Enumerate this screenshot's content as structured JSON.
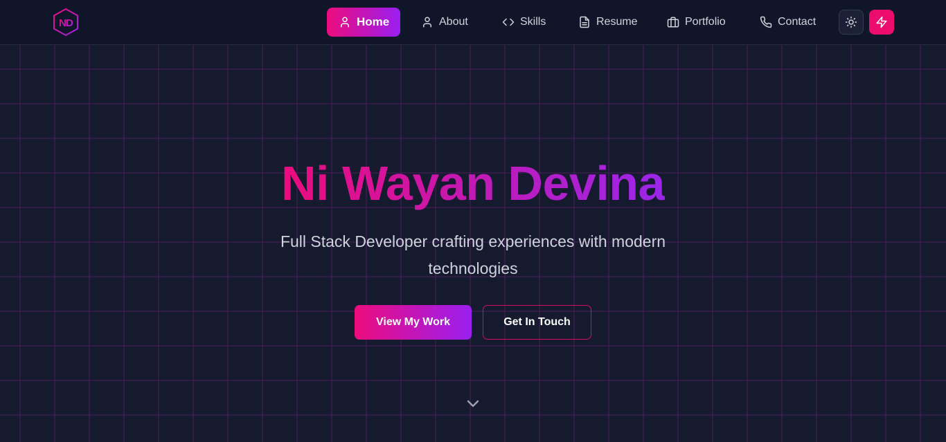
{
  "brand": {
    "logo_text": "ND",
    "logo_icon": "hexagon-monogram-icon"
  },
  "nav": {
    "items": [
      {
        "label": "Home",
        "icon": "user-icon",
        "active": true
      },
      {
        "label": "About",
        "icon": "user-icon",
        "active": false
      },
      {
        "label": "Skills",
        "icon": "code-icon",
        "active": false
      },
      {
        "label": "Resume",
        "icon": "document-icon",
        "active": false
      },
      {
        "label": "Portfolio",
        "icon": "briefcase-icon",
        "active": false
      },
      {
        "label": "Contact",
        "icon": "phone-icon",
        "active": false
      }
    ],
    "theme_toggle_icon": "sun-icon",
    "action_icon": "lightning-icon"
  },
  "hero": {
    "title": "Ni Wayan Devina",
    "subtitle": "Full Stack Developer crafting experiences with modern technologies",
    "primary_button": "View My Work",
    "secondary_button": "Get In Touch",
    "scroll_icon": "chevron-down-icon"
  },
  "colors": {
    "background": "#161a2f",
    "navbar": "#11152a",
    "accent_pink": "#ec0c7d",
    "accent_purple": "#9a1ff0",
    "grid_line": "#5c1f6a"
  }
}
